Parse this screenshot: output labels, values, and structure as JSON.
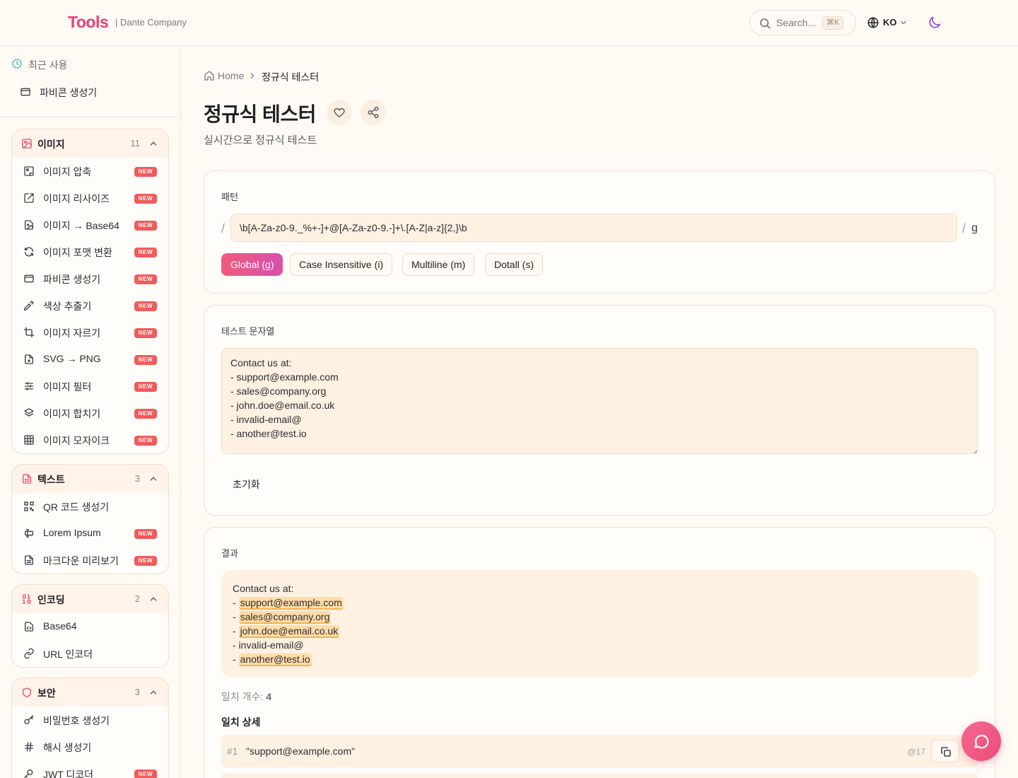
{
  "header": {
    "logo": "Tools",
    "company": "| Dante Company",
    "search_placeholder": "Search...",
    "search_shortcut": "⌘K",
    "language": "KO"
  },
  "sidebar": {
    "recent_label": "최근 사용",
    "recent_items": [
      {
        "label": "파비콘 생성기"
      }
    ],
    "groups": [
      {
        "label": "이미지",
        "count": "11",
        "items": [
          {
            "label": "이미지 압축",
            "badge": "NEW"
          },
          {
            "label": "이미지 리사이즈",
            "badge": "NEW"
          },
          {
            "label": "이미지 → Base64",
            "badge": "NEW"
          },
          {
            "label": "이미지 포맷 변환",
            "badge": "NEW"
          },
          {
            "label": "파비콘 생성기",
            "badge": "NEW"
          },
          {
            "label": "색상 추출기",
            "badge": "NEW"
          },
          {
            "label": "이미지 자르기",
            "badge": "NEW"
          },
          {
            "label": "SVG → PNG",
            "badge": "NEW"
          },
          {
            "label": "이미지 필터",
            "badge": "NEW"
          },
          {
            "label": "이미지 합치기",
            "badge": "NEW"
          },
          {
            "label": "이미지 모자이크",
            "badge": "NEW"
          }
        ]
      },
      {
        "label": "텍스트",
        "count": "3",
        "items": [
          {
            "label": "QR 코드 생성기",
            "badge": ""
          },
          {
            "label": "Lorem Ipsum",
            "badge": "NEW"
          },
          {
            "label": "마크다운 미리보기",
            "badge": "NEW"
          }
        ]
      },
      {
        "label": "인코딩",
        "count": "2",
        "items": [
          {
            "label": "Base64",
            "badge": ""
          },
          {
            "label": "URL 인코더",
            "badge": ""
          }
        ]
      },
      {
        "label": "보안",
        "count": "3",
        "items": [
          {
            "label": "비밀번호 생성기",
            "badge": ""
          },
          {
            "label": "해시 생성기",
            "badge": ""
          },
          {
            "label": "JWT 디코더",
            "badge": "NEW"
          }
        ]
      }
    ]
  },
  "breadcrumb": {
    "home": "Home",
    "current": "정규식 테스터"
  },
  "page": {
    "title": "정규식 테스터",
    "subtitle": "실시간으로 정규식 테스트"
  },
  "pattern": {
    "label": "패턴",
    "slash": "/",
    "value": "\\b[A-Za-z0-9._%+-]+@[A-Za-z0-9.-]+\\.[A-Z|a-z]{2,}\\b",
    "flags_text": "g",
    "flags": [
      {
        "label": "Global (g)",
        "active": true
      },
      {
        "label": "Case Insensitive (i)",
        "active": false
      },
      {
        "label": "Multiline (m)",
        "active": false
      },
      {
        "label": "Dotall (s)",
        "active": false
      }
    ]
  },
  "test_string": {
    "label": "테스트 문자열",
    "value": "Contact us at:\n- support@example.com\n- sales@company.org\n- john.doe@email.co.uk\n- invalid-email@\n- another@test.io",
    "reset_label": "초기화"
  },
  "result": {
    "label": "결과",
    "lines": [
      {
        "prefix": "Contact us at:",
        "match": ""
      },
      {
        "prefix": "- ",
        "match": "support@example.com"
      },
      {
        "prefix": "- ",
        "match": "sales@company.org"
      },
      {
        "prefix": "- ",
        "match": "john.doe@email.co.uk"
      },
      {
        "prefix": "- invalid-email@",
        "match": ""
      },
      {
        "prefix": "- ",
        "match": "another@test.io"
      }
    ],
    "count_label": "일치 개수:",
    "count": "4",
    "details_label": "일치 상세",
    "details": [
      {
        "index": "#1",
        "value": "\"support@example.com\"",
        "position": "@17"
      },
      {
        "index": "",
        "value": "",
        "position": ""
      }
    ]
  },
  "colors": {
    "accent": "#ec4a7a",
    "badge": "#f15b5b",
    "highlight": "#ffdca8"
  }
}
